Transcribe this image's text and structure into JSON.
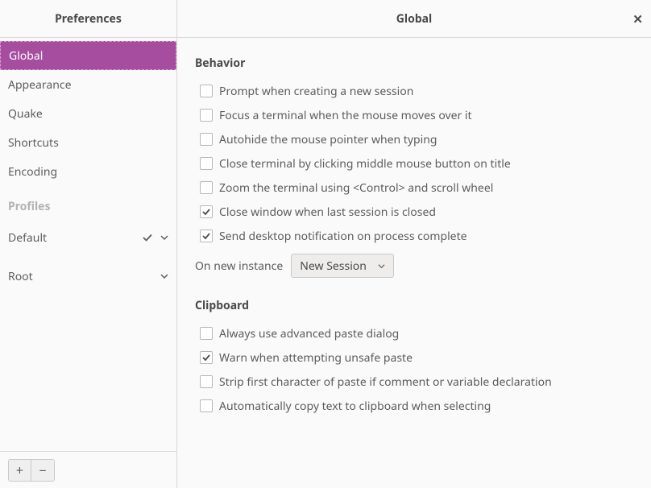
{
  "sidebar": {
    "title": "Preferences",
    "items": [
      {
        "label": "Global",
        "selected": true
      },
      {
        "label": "Appearance",
        "selected": false
      },
      {
        "label": "Quake",
        "selected": false
      },
      {
        "label": "Shortcuts",
        "selected": false
      },
      {
        "label": "Encoding",
        "selected": false
      }
    ],
    "profiles_label": "Profiles",
    "profiles": [
      {
        "name": "Default",
        "is_default": true
      },
      {
        "name": "Root",
        "is_default": false
      }
    ],
    "add_label": "+",
    "remove_label": "−"
  },
  "content": {
    "title": "Global",
    "close_label": "✕",
    "behavior": {
      "title": "Behavior",
      "options": [
        {
          "label": "Prompt when creating a new session",
          "checked": false
        },
        {
          "label": "Focus a terminal when the mouse moves over it",
          "checked": false
        },
        {
          "label": "Autohide the mouse pointer when typing",
          "checked": false
        },
        {
          "label": "Close terminal by clicking middle mouse button on title",
          "checked": false
        },
        {
          "label": "Zoom the terminal using <Control> and scroll wheel",
          "checked": false
        },
        {
          "label": "Close window when last session is closed",
          "checked": true
        },
        {
          "label": "Send desktop notification on process complete",
          "checked": true
        }
      ],
      "on_new_instance_label": "On new instance",
      "on_new_instance_value": "New Session"
    },
    "clipboard": {
      "title": "Clipboard",
      "options": [
        {
          "label": "Always use advanced paste dialog",
          "checked": false
        },
        {
          "label": "Warn when attempting unsafe paste",
          "checked": true
        },
        {
          "label": "Strip first character of paste if comment or variable declaration",
          "checked": false
        },
        {
          "label": "Automatically copy text to clipboard when selecting",
          "checked": false
        }
      ]
    }
  }
}
